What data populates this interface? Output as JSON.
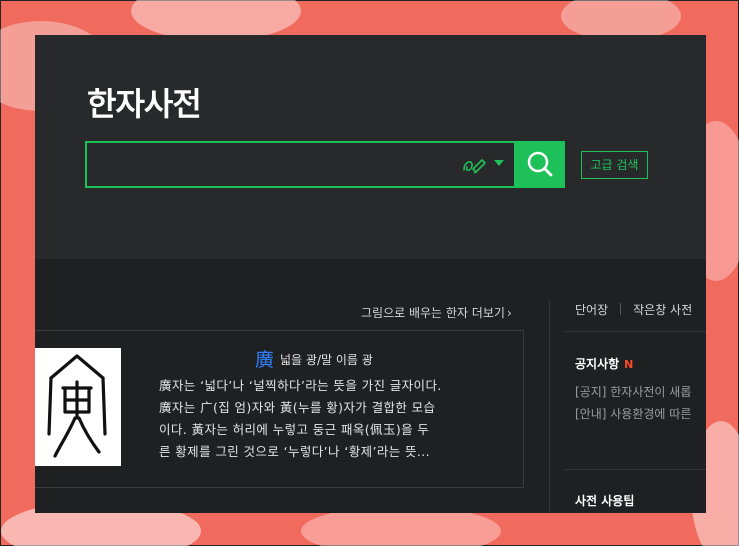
{
  "header": {
    "title": "한자사전",
    "search": {
      "value": "",
      "placeholder": "",
      "hand_icon": "handwriting-input-icon",
      "dropdown_icon": "caret-down-icon"
    },
    "search_button_icon": "search-icon",
    "advanced_search_label": "고급 검색"
  },
  "colors": {
    "accent": "#1ec05a",
    "hanja_highlight": "#2f7fff",
    "new_badge": "#ff4b2b"
  },
  "main": {
    "more_link": "그림으로 배우는 한자 더보기",
    "card": {
      "hanja": "廣",
      "meaning": "넓을 광/말 이름 광",
      "desc_lines": [
        "廣자는 ‘넓다’나 ‘널찍하다’라는 뜻을 가진 글자이다.",
        "廣자는 广(집 엄)자와 黃(누를 황)자가 결합한 모습",
        "이다. 黃자는 허리에 누렇고 둥근 패옥(佩玉)을 두",
        "른 황제를 그린 것으로 ‘누렇다’나 ‘황제’라는 뜻..."
      ]
    }
  },
  "sidebar": {
    "tabs": [
      "단어장",
      "작은창 사전"
    ],
    "notice_title": "공지사항",
    "notice_new": "N",
    "notices": [
      "[공지] 한자사전이 새롭",
      "[안내] 사용환경에 따른"
    ],
    "tip_title": "사전 사용팁"
  }
}
